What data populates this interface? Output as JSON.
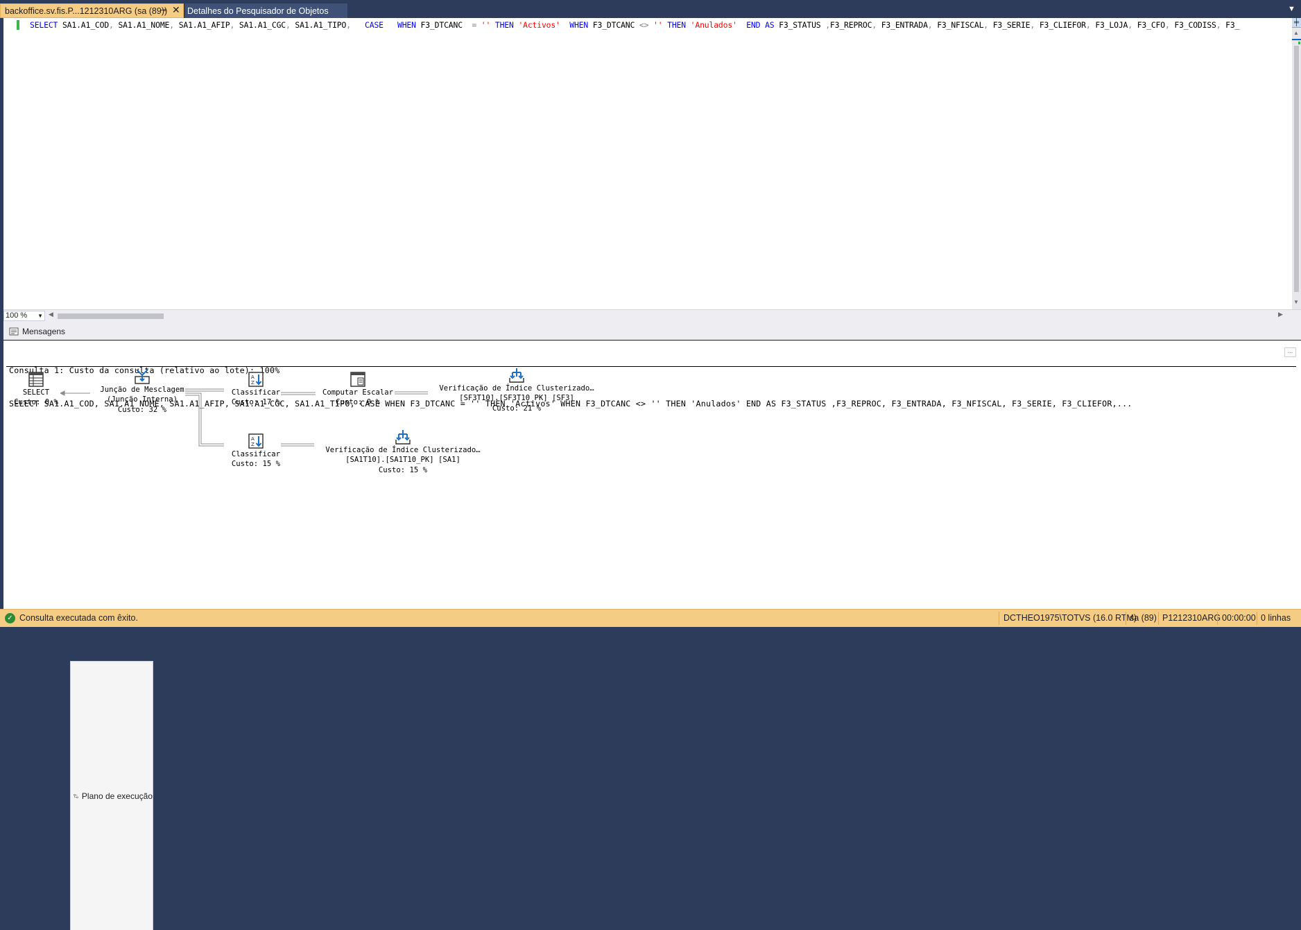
{
  "tabs": {
    "active": {
      "title": "backoffice.sv.fis.P...1212310ARG (sa (89))",
      "pin_icon": "pin-icon",
      "close_icon": "close-icon"
    },
    "inactive": {
      "title": "Detalhes do Pesquisador de Objetos"
    }
  },
  "editor": {
    "query_segments": [
      {
        "t": "SELECT ",
        "c": "kw"
      },
      {
        "t": "SA1.A1_COD",
        "c": ""
      },
      {
        "t": ", ",
        "c": "op"
      },
      {
        "t": "SA1.A1_NOME",
        "c": ""
      },
      {
        "t": ", ",
        "c": "op"
      },
      {
        "t": "SA1.A1_AFIP",
        "c": ""
      },
      {
        "t": ", ",
        "c": "op"
      },
      {
        "t": "SA1.A1_CGC",
        "c": ""
      },
      {
        "t": ", ",
        "c": "op"
      },
      {
        "t": "SA1.A1_TIPO",
        "c": ""
      },
      {
        "t": ",   ",
        "c": "op"
      },
      {
        "t": "CASE   WHEN ",
        "c": "kw"
      },
      {
        "t": "F3_DTCANC  ",
        "c": ""
      },
      {
        "t": "= ",
        "c": "op"
      },
      {
        "t": "'' ",
        "c": "str"
      },
      {
        "t": "THEN ",
        "c": "kw"
      },
      {
        "t": "'Activos'  ",
        "c": "str"
      },
      {
        "t": "WHEN ",
        "c": "kw"
      },
      {
        "t": "F3_DTCANC ",
        "c": ""
      },
      {
        "t": "<> ",
        "c": "op"
      },
      {
        "t": "'' ",
        "c": "str"
      },
      {
        "t": "THEN ",
        "c": "kw"
      },
      {
        "t": "'Anulados'  ",
        "c": "str"
      },
      {
        "t": "END AS ",
        "c": "kw"
      },
      {
        "t": "F3_STATUS ",
        "c": ""
      },
      {
        "t": ",",
        "c": "op"
      },
      {
        "t": "F3_REPROC",
        "c": ""
      },
      {
        "t": ", ",
        "c": "op"
      },
      {
        "t": "F3_ENTRADA",
        "c": ""
      },
      {
        "t": ", ",
        "c": "op"
      },
      {
        "t": "F3_NFISCAL",
        "c": ""
      },
      {
        "t": ", ",
        "c": "op"
      },
      {
        "t": "F3_SERIE",
        "c": ""
      },
      {
        "t": ", ",
        "c": "op"
      },
      {
        "t": "F3_CLIEFOR",
        "c": ""
      },
      {
        "t": ", ",
        "c": "op"
      },
      {
        "t": "F3_LOJA",
        "c": ""
      },
      {
        "t": ", ",
        "c": "op"
      },
      {
        "t": "F3_CFO",
        "c": ""
      },
      {
        "t": ", ",
        "c": "op"
      },
      {
        "t": "F3_CODISS",
        "c": ""
      },
      {
        "t": ", ",
        "c": "op"
      },
      {
        "t": "F3_",
        "c": ""
      }
    ],
    "zoom": "100 %"
  },
  "results_tabs": {
    "messages": "Mensagens",
    "plan": "Plano de execução"
  },
  "plan": {
    "header_line1": "Consulta 1: Custo da consulta (relativo ao lote): 100%",
    "header_line2": "SELECT SA1.A1_COD, SA1.A1_NOME, SA1.A1_AFIP, SA1.A1_CGC, SA1.A1_TIPO, CASE WHEN F3_DTCANC = '' THEN 'Activos' WHEN F3_DTCANC <> '' THEN 'Anulados' END AS F3_STATUS ,F3_REPROC, F3_ENTRADA, F3_NFISCAL, F3_SERIE, F3_CLIEFOR,...",
    "nodes": {
      "select": {
        "name": "SELECT",
        "cost": "Custo: 0 %",
        "icon": "select-result-icon"
      },
      "merge": {
        "name": "Junção de Mesclagem",
        "sub": "(Junção Interna)",
        "cost": "Custo: 32 %",
        "icon": "merge-join-icon"
      },
      "sort1": {
        "name": "Classificar",
        "cost": "Custo: 17 %",
        "icon": "sort-icon"
      },
      "compute": {
        "name": "Computar Escalar",
        "cost": "Custo: 0 %",
        "icon": "compute-scalar-icon"
      },
      "seek1": {
        "name": "Verificação de Índice Clusterizado…",
        "sub": "[SF3T10].[SF3T10_PK] [SF3]",
        "cost": "Custo: 21 %",
        "icon": "clustered-index-scan-icon"
      },
      "sort2": {
        "name": "Classificar",
        "cost": "Custo: 15 %",
        "icon": "sort-icon"
      },
      "seek2": {
        "name": "Verificação de Índice Clusterizado…",
        "sub": "[SA1T10].[SA1T10_PK] [SA1]",
        "cost": "Custo: 15 %",
        "icon": "clustered-index-scan-icon"
      }
    }
  },
  "status": {
    "message": "Consulta executada com êxito.",
    "server": "DCTHEO1975\\TOTVS (16.0 RTM)",
    "user": "sa (89)",
    "database": "P1212310ARG",
    "time": "00:00:00",
    "rows": "0 linhas"
  },
  "colors": {
    "accent_tab": "#f5cc84",
    "chrome": "#2d3c5a",
    "keyword": "#0000ff",
    "string": "#ff0000",
    "success": "#2c8c33"
  }
}
